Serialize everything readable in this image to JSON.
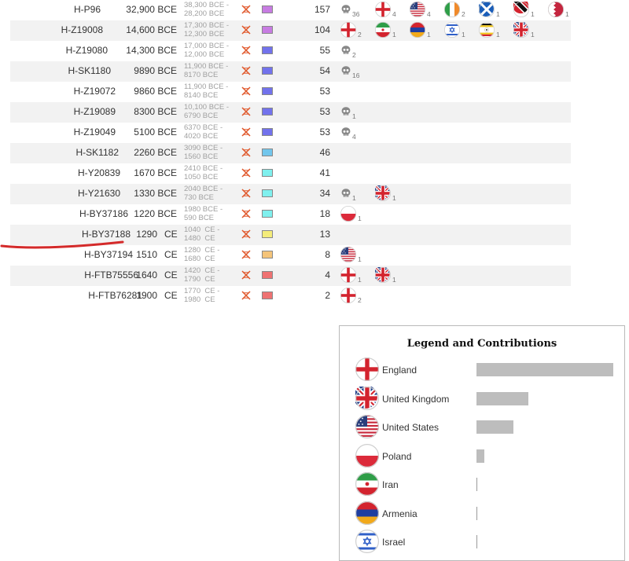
{
  "rows": [
    {
      "name": "H-P96",
      "year": "32,900 BCE",
      "era": "",
      "ci": [
        "38,300 BCE -",
        "28,200 BCE"
      ],
      "swatch": "#c77ce2",
      "count": "157",
      "cells": [
        {
          "icon": "skull-icon",
          "n": "36"
        },
        {
          "icon": "england-flag-icon",
          "n": "4"
        },
        {
          "icon": "united-states-flag-icon",
          "n": "4"
        },
        {
          "icon": "ireland-flag-icon",
          "n": "2"
        },
        {
          "icon": "scotland-flag-icon",
          "n": "1"
        },
        {
          "icon": "trinidad-flag-icon",
          "n": "1"
        },
        {
          "icon": "bahrain-flag-icon",
          "n": "1"
        }
      ]
    },
    {
      "name": "H-Z19008",
      "year": "14,600 BCE",
      "era": "",
      "ci": [
        "17,300 BCE -",
        "12,300 BCE"
      ],
      "swatch": "#c77ce2",
      "count": "104",
      "cells": [
        {
          "icon": "england-flag-icon",
          "n": "2"
        },
        {
          "icon": "iran-flag-icon",
          "n": "1"
        },
        {
          "icon": "armenia-flag-icon",
          "n": "1"
        },
        {
          "icon": "israel-flag-icon",
          "n": "1"
        },
        {
          "icon": "uganda-flag-icon",
          "n": "1"
        },
        {
          "icon": "united-kingdom-flag-icon",
          "n": "1"
        }
      ]
    },
    {
      "name": "H-Z19080",
      "year": "14,300 BCE",
      "era": "",
      "ci": [
        "17,000 BCE -",
        "12,000 BCE"
      ],
      "swatch": "#7272ec",
      "count": "55",
      "cells": [
        {
          "icon": "skull-icon",
          "n": "2"
        }
      ]
    },
    {
      "name": "H-SK1180",
      "year": "9890 BCE",
      "era": "",
      "ci": [
        "11,900 BCE -",
        "8170 BCE"
      ],
      "swatch": "#7272ec",
      "count": "54",
      "cells": [
        {
          "icon": "skull-icon",
          "n": "16"
        }
      ]
    },
    {
      "name": "H-Z19072",
      "year": "9860 BCE",
      "era": "",
      "ci": [
        "11,900 BCE -",
        "8140 BCE"
      ],
      "swatch": "#7272ec",
      "count": "53",
      "cells": []
    },
    {
      "name": "H-Z19089",
      "year": "8300 BCE",
      "era": "",
      "ci": [
        "10,100 BCE -",
        "6790 BCE"
      ],
      "swatch": "#7272ec",
      "count": "53",
      "cells": [
        {
          "icon": "skull-icon",
          "n": "1"
        }
      ]
    },
    {
      "name": "H-Z19049",
      "year": "5100 BCE",
      "era": "",
      "ci": [
        "6370 BCE -",
        "4020 BCE"
      ],
      "swatch": "#7272ec",
      "count": "53",
      "cells": [
        {
          "icon": "skull-icon",
          "n": "4"
        }
      ]
    },
    {
      "name": "H-SK1182",
      "year": "2260 BCE",
      "era": "",
      "ci": [
        "3090 BCE -",
        "1560 BCE"
      ],
      "swatch": "#72c6ec",
      "count": "46",
      "cells": []
    },
    {
      "name": "H-Y20839",
      "year": "1670 BCE",
      "era": "",
      "ci": [
        "2410 BCE -",
        "1050 BCE"
      ],
      "swatch": "#7ff0ee",
      "count": "41",
      "cells": []
    },
    {
      "name": "H-Y21630",
      "year": "1330 BCE",
      "era": "",
      "ci": [
        "2040 BCE -",
        "730 BCE"
      ],
      "swatch": "#7ff0ee",
      "count": "34",
      "cells": [
        {
          "icon": "skull-icon",
          "n": "1"
        },
        {
          "icon": "united-kingdom-flag-icon",
          "n": "1"
        }
      ]
    },
    {
      "name": "H-BY37186",
      "year": "1220 BCE",
      "era": "",
      "ci": [
        "1980 BCE -",
        "590 BCE"
      ],
      "swatch": "#7ff0ee",
      "count": "18",
      "cells": [
        {
          "icon": "poland-flag-icon",
          "n": "1"
        }
      ]
    },
    {
      "name": "H-BY37188",
      "year": "1290",
      "era": "CE",
      "ci": [
        "1040  CE -",
        "1480  CE"
      ],
      "swatch": "#f4ec7a",
      "count": "13",
      "cells": []
    },
    {
      "name": "H-BY37194",
      "year": "1510",
      "era": "CE",
      "ci": [
        "1280  CE -",
        "1680  CE"
      ],
      "swatch": "#f4c47a",
      "count": "8",
      "cells": [
        {
          "icon": "united-states-flag-icon",
          "n": "1"
        }
      ]
    },
    {
      "name": "H-FTB75556",
      "year": "1640",
      "era": "CE",
      "ci": [
        "1420  CE -",
        "1790  CE"
      ],
      "swatch": "#ee7272",
      "count": "4",
      "cells": [
        {
          "icon": "england-flag-icon",
          "n": "1"
        },
        {
          "icon": "united-kingdom-flag-icon",
          "n": "1"
        }
      ]
    },
    {
      "name": "H-FTB76281",
      "year": "1900",
      "era": "CE",
      "ci": [
        "1770  CE -",
        "1980  CE"
      ],
      "swatch": "#ee7272",
      "count": "2",
      "cells": [
        {
          "icon": "england-flag-icon",
          "n": "2"
        }
      ]
    }
  ],
  "legend": {
    "title": "Legend and Contributions",
    "items": [
      {
        "label": "England",
        "icon": "england-flag-icon",
        "share": 1.0
      },
      {
        "label": "United Kingdom",
        "icon": "united-kingdom-flag-icon",
        "share": 0.38
      },
      {
        "label": "United States",
        "icon": "united-states-flag-icon",
        "share": 0.27
      },
      {
        "label": "Poland",
        "icon": "poland-flag-icon",
        "share": 0.06
      },
      {
        "label": "Iran",
        "icon": "iran-flag-icon",
        "share": 0.005
      },
      {
        "label": "Armenia",
        "icon": "armenia-flag-icon",
        "share": 0.005
      },
      {
        "label": "Israel",
        "icon": "israel-flag-icon",
        "share": 0.005
      }
    ]
  },
  "colors": {
    "alt_row": "#f2f2f2",
    "bar": "#bdbdbd",
    "annotation": "#d42a2a",
    "dna": "#e0572a"
  }
}
